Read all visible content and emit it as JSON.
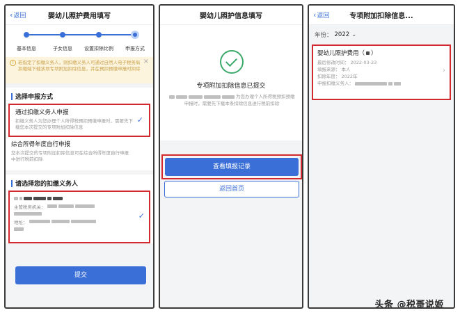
{
  "screen1": {
    "back_label": "返回",
    "title": "婴幼儿照护费用填写",
    "steps": [
      "基本信息",
      "子女信息",
      "设置扣除比例",
      "申报方式"
    ],
    "notice": "若指定了扣缴义务人，则扣缴义务人可通过自然人电子税务局扣缴端下载该项专项附加扣除信息，并在预扣预缴申报时扣除",
    "method_section": "选择申报方式",
    "options": [
      {
        "title": "通过扣缴义务人申报",
        "desc": "扣缴义务人为您办理个人所得税预扣预缴申报时，需要先下载您本次提交的专项附加扣除信息",
        "selected": true
      },
      {
        "title": "综合所得年度自行申报",
        "desc": "您本次提交的专项附加扣除信息可在综合所得年度自行申报中进行税前扣除",
        "selected": false
      }
    ],
    "agent_section": "请选择您的扣缴义务人",
    "agent": {
      "tax_office_label": "主管税务机关：",
      "address_label": "地址："
    },
    "submit_label": "提交"
  },
  "screen2": {
    "title": "婴幼儿照护信息填写",
    "status": "专项附加扣除信息已提交",
    "desc": "为您办理个人所得税预扣预缴申报时，需要先下载本条扣除信息进行税前扣除",
    "primary_label": "查看填报记录",
    "secondary_label": "返回首页"
  },
  "screen3": {
    "back_label": "返回",
    "title": "专项附加扣除信息...",
    "year_label": "年份：",
    "year_value": "2022",
    "record": {
      "title": "婴幼儿照护费用（",
      "title_end": "）",
      "modified_label": "最后修改时间：",
      "modified_value": "2022-03-23",
      "source_label": "填报来源：",
      "source_value": "本人",
      "deduct_year_label": "扣除年度：",
      "deduct_year_value": "2022年",
      "agent_label": "申报扣缴义务人："
    }
  },
  "watermark": "头条 @税哥说姬",
  "colors": {
    "primary": "#3b6fd8",
    "highlight": "#d2282e",
    "success": "#3aa96a",
    "notice_bg": "#fdf4dd"
  }
}
